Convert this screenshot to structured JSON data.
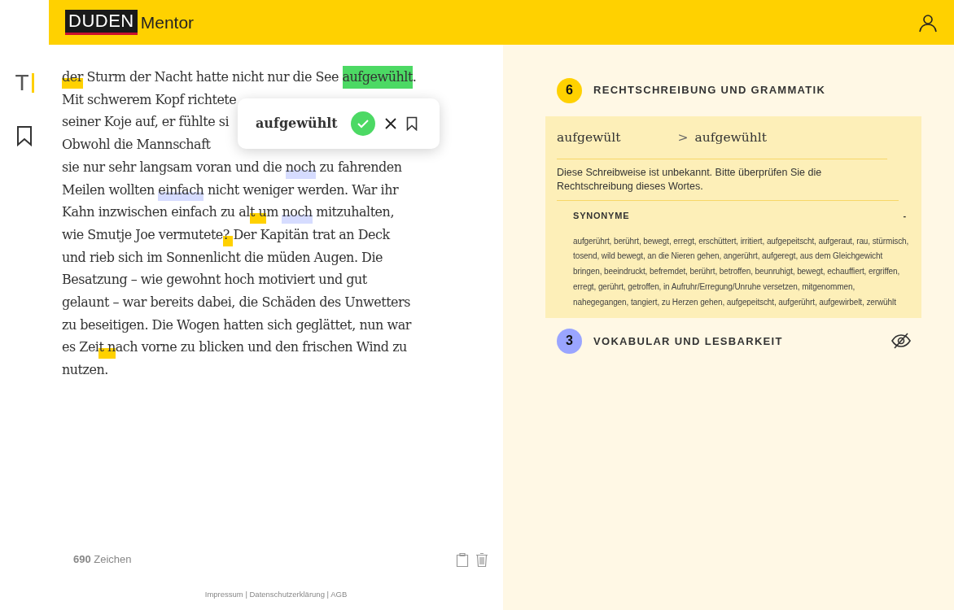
{
  "header": {
    "logo": "DUDEN",
    "product": "Mentor"
  },
  "sidebar": {
    "cursor_glyph": "T"
  },
  "editor": {
    "lines": [
      {
        "segments": [
          {
            "text": "der",
            "kind": "error"
          },
          {
            "text": " Sturm der Nacht hatte nicht nur die See ",
            "kind": "plain"
          },
          {
            "text": "aufgewühlt",
            "kind": "accepted"
          },
          {
            "text": ".",
            "kind": "plain"
          }
        ]
      },
      {
        "segments": [
          {
            "text": "Mit schwerem Kopf richtete",
            "kind": "plain"
          }
        ]
      },
      {
        "segments": [
          {
            "text": "seiner Koje auf, er fühlte si",
            "kind": "plain"
          }
        ]
      },
      {
        "segments": [
          {
            "text": "Obwohl die Mannschaft",
            "kind": "plain"
          }
        ]
      },
      {
        "segments": [
          {
            "text": "sie nur sehr langsam voran und die ",
            "kind": "plain"
          },
          {
            "text": "noch",
            "kind": "style"
          },
          {
            "text": " zu fahrenden",
            "kind": "plain"
          }
        ]
      },
      {
        "segments": [
          {
            "text": "Meilen wollten ",
            "kind": "plain"
          },
          {
            "text": "einfach",
            "kind": "style"
          },
          {
            "text": " nicht weniger werden. War ihr",
            "kind": "plain"
          }
        ]
      },
      {
        "segments": [
          {
            "text": "Kahn inzwischen einfach zu al",
            "kind": "plain"
          },
          {
            "text": "t u",
            "kind": "error"
          },
          {
            "text": "m ",
            "kind": "plain"
          },
          {
            "text": "noch",
            "kind": "style"
          },
          {
            "text": " mitzuhalten,",
            "kind": "plain"
          }
        ]
      },
      {
        "segments": [
          {
            "text": "wie Smutje Joe vermutete",
            "kind": "plain"
          },
          {
            "text": "? ",
            "kind": "error"
          },
          {
            "text": "Der Kapitän trat an Deck",
            "kind": "plain"
          }
        ]
      },
      {
        "segments": [
          {
            "text": "und rieb sich im Sonnenlicht die müden Augen. Die",
            "kind": "plain"
          }
        ]
      },
      {
        "segments": [
          {
            "text": "Besatzung – wie gewohnt hoch motiviert und gut",
            "kind": "plain"
          }
        ]
      },
      {
        "segments": [
          {
            "text": "gelaunt – war bereits dabei, die Schäden des Unwetters",
            "kind": "plain"
          }
        ]
      },
      {
        "segments": [
          {
            "text": "zu beseitigen. Die Wogen hatten sich geglättet, nun war",
            "kind": "plain"
          }
        ]
      },
      {
        "segments": [
          {
            "text": "es Zei",
            "kind": "plain"
          },
          {
            "text": "t n",
            "kind": "error"
          },
          {
            "text": "ach vorne zu blicken und den frischen Wind zu",
            "kind": "plain"
          }
        ]
      },
      {
        "segments": [
          {
            "text": "nutzen.",
            "kind": "plain"
          }
        ]
      }
    ],
    "popup": {
      "word": "aufgewühlt"
    },
    "char_count": {
      "number": "690",
      "label": "Zeichen"
    },
    "footer_links": [
      "Impressum",
      "|",
      "Datenschutzerklärung",
      "|",
      "AGB"
    ]
  },
  "panel": {
    "sections": [
      {
        "count": "6",
        "title": "RECHTSCHREIBUNG UND GRAMMATIK",
        "color": "#ffd100",
        "hidden": false,
        "detail": {
          "original": "aufgewült",
          "arrow": ">",
          "suggestion": "aufgewühlt",
          "message": "Diese Schreibweise ist unbekannt. Bitte überprüfen Sie die Rechtschreibung dieses Wortes.",
          "synonyms_title": "SYNONYME",
          "collapse_glyph": "-",
          "synonyms": "aufgerührt, berührt, bewegt, erregt, erschüttert, irritiert, aufgepeitscht, aufgeraut, rau, stürmisch, tosend, wild bewegt, an die Nieren gehen, angerührt, aufgeregt, aus dem Gleichgewicht bringen, beeindruckt, befremdet, berührt, betroffen, beunruhigt, bewegt, echauffiert, ergriffen, erregt, gerührt, getroffen, in Aufruhr/Erregung/Unruhe versetzen, mitgenommen, nahegegangen, tangiert, zu Herzen gehen, aufgepeitscht, aufgerührt, aufgewirbelt, zerwühlt"
        }
      },
      {
        "count": "3",
        "title": "VOKABULAR UND LESBARKEIT",
        "color": "#9aa5ff",
        "hidden": true
      }
    ]
  }
}
